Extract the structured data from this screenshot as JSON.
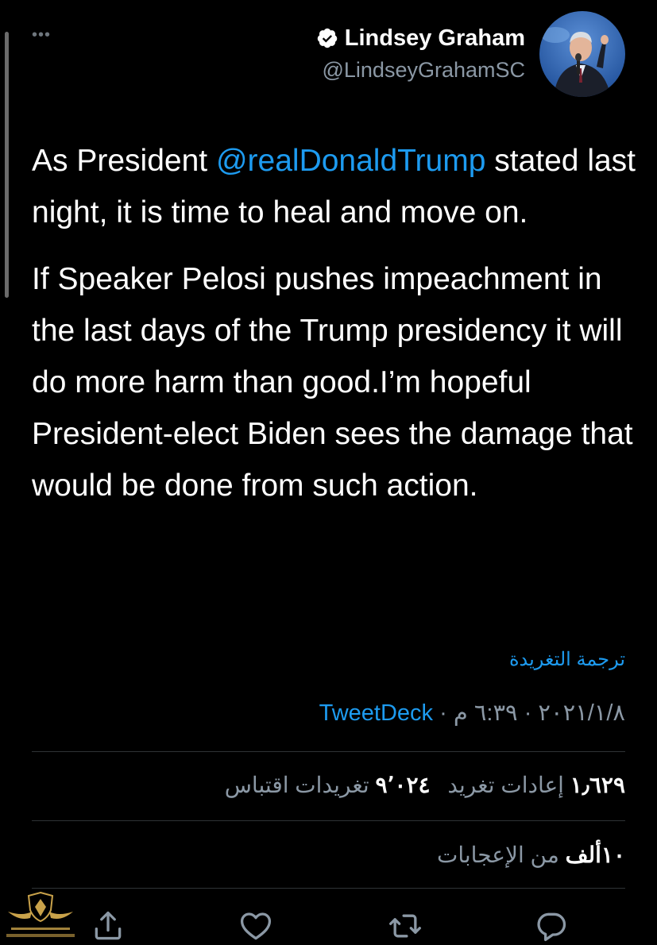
{
  "header": {
    "display_name": "Lindsey Graham",
    "handle": "@LindseyGrahamSC",
    "more_icon": "more-dots-icon",
    "verified_icon": "verified-badge-icon"
  },
  "tweet": {
    "p1_prefix": "As President ",
    "p1_mention": "@realDonaldTrump",
    "p1_suffix": " stated last night, it is time to heal and move on.",
    "p2": "If Speaker Pelosi pushes impeachment in the last days of the Trump presidency it will do more harm than good.I’m hopeful President-elect Biden sees the damage that would be done from such action."
  },
  "translate_label": "ترجمة التغريدة",
  "meta": {
    "date": "٢٠٢١/١/٨",
    "time": "٦:٣٩ م",
    "separator": " · ",
    "source": "TweetDeck"
  },
  "stats": {
    "retweets_count": "١٫٦٢٩",
    "retweets_label": "إعادات تغريد",
    "quotes_count": "٩٬٠٢٤",
    "quotes_label": "تغريدات اقتباس",
    "likes_count": "١٠ألف",
    "likes_label": "من الإعجابات"
  },
  "actions": [
    "reply-icon",
    "retweet-icon",
    "like-icon",
    "share-icon"
  ],
  "colors": {
    "background": "#000000",
    "text": "#ffffff",
    "secondary": "#8b98a5",
    "accent": "#1d9bf0",
    "divider": "#2f3336"
  }
}
